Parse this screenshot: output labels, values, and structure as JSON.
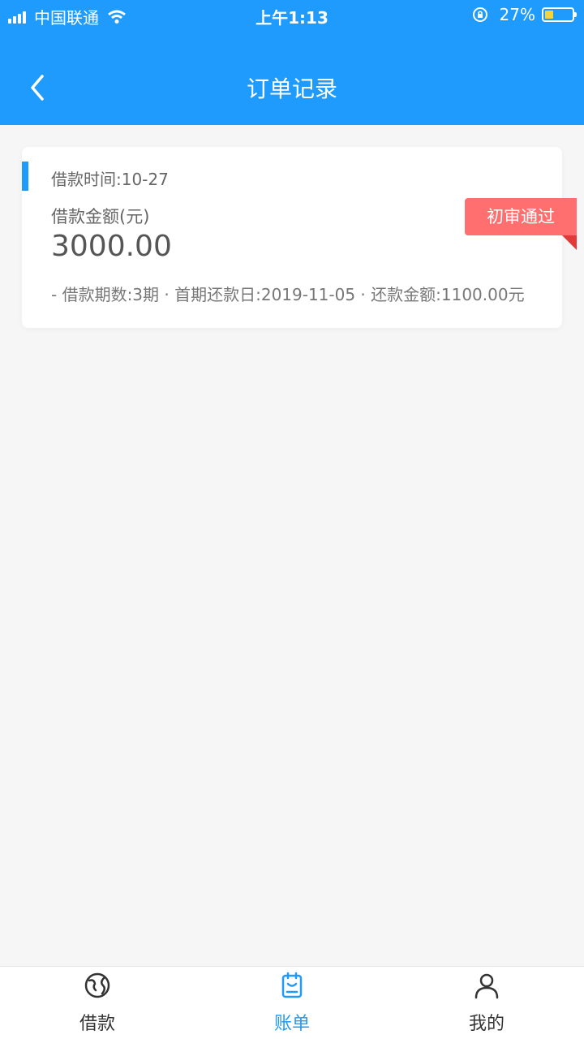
{
  "statusbar": {
    "carrier": "中国联通",
    "time": "上午1:13",
    "battery": "27%"
  },
  "nav": {
    "title": "订单记录",
    "back_icon": "chevron-left-icon"
  },
  "order": {
    "loan_time": "借款时间:10-27",
    "amount_label": "借款金额(元)",
    "amount": "3000.00",
    "details": "- 借款期数:3期 · 首期还款日:2019-11-05 · 还款金额:1100.00元",
    "status_badge": "初审通过"
  },
  "tabs": [
    {
      "label": "借款",
      "icon": "globe-icon",
      "active": false
    },
    {
      "label": "账单",
      "icon": "bill-icon",
      "active": true
    },
    {
      "label": "我的",
      "icon": "user-icon",
      "active": false
    }
  ],
  "colors": {
    "primary": "#1e9bfd",
    "badge": "#ff6f6f",
    "background": "#f6f6f6"
  }
}
